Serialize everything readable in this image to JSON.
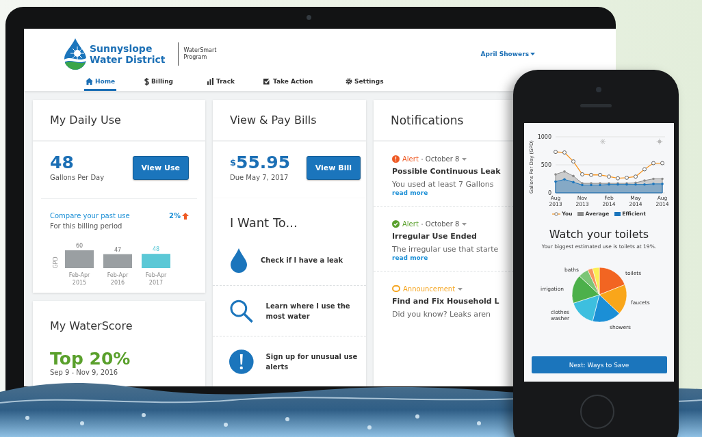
{
  "header": {
    "logo_lines": [
      "Sunnyslope",
      "Water District"
    ],
    "program_lines": [
      "WaterSmart",
      "Program"
    ],
    "user": "April Showers"
  },
  "nav": [
    {
      "kind": "home",
      "label": "Home",
      "selected": true
    },
    {
      "kind": "dollar",
      "label": "Billing",
      "selected": false
    },
    {
      "kind": "bars",
      "label": "Track",
      "selected": false
    },
    {
      "kind": "check",
      "label": "Take Action",
      "selected": false
    },
    {
      "kind": "gear",
      "label": "Settings",
      "selected": false
    }
  ],
  "daily_use": {
    "title": "My Daily Use",
    "value": "48",
    "unit": "Gallons Per Day",
    "button": "View Use",
    "compare_link": "Compare your past use",
    "change": "2%",
    "period": "For this billing period",
    "chart_data": {
      "type": "bar",
      "ylabel": "GPD",
      "categories": [
        "Feb-Apr 2015",
        "Feb-Apr 2016",
        "Feb-Apr 2017"
      ],
      "values": [
        60,
        47,
        48
      ],
      "data_labels": true
    }
  },
  "water_score": {
    "title": "My WaterScore",
    "rank": "Top 20%",
    "dates": "Sep 9 - Nov 9, 2016"
  },
  "bills": {
    "title": "View & Pay Bills",
    "currency": "$",
    "amount": "55.95",
    "due": "Due May 7, 2017",
    "button": "View Bill"
  },
  "actions": {
    "title": "I Want To...",
    "items": [
      {
        "kind": "drop",
        "label": "Check if I have a leak"
      },
      {
        "kind": "search",
        "label": "Learn where I use the most water"
      },
      {
        "kind": "exclamation",
        "label": "Sign up for unusual use alerts"
      }
    ]
  },
  "notifications": {
    "title": "Notifications",
    "items": [
      {
        "kind": "alert",
        "color": "#ef5a24",
        "type_label": "Alert",
        "date": "October 8",
        "title": "Possible Continuous Leak",
        "body": "You used at least 7 Gallons",
        "link": "read more"
      },
      {
        "kind": "resolved",
        "color": "#5aa02c",
        "type_label": "Alert",
        "date": "October 8",
        "title": "Irregular Use Ended",
        "body": "The irregular use that starte",
        "link": "read more"
      },
      {
        "kind": "announcement",
        "color": "#f5a623",
        "type_label": "Announcement",
        "title": "Find and Fix Household L",
        "body": "Did you know? Leaks aren"
      }
    ]
  },
  "phone": {
    "usage_chart": {
      "chart_data": {
        "type": "line",
        "ylabel": "Gallons Per Day (GPD)",
        "categories": [
          "Aug 2013",
          null,
          null,
          "Nov 2013",
          null,
          null,
          "Feb 2014",
          null,
          null,
          "May 2014",
          null,
          null,
          "Aug 2014"
        ],
        "ylim": [
          0,
          1000
        ],
        "yticks": [
          0,
          500,
          1000
        ],
        "legend": "bottom",
        "series": [
          {
            "name": "You",
            "type": "line",
            "marker": "circle",
            "color": "#f7941d",
            "values": [
              730,
              720,
              560,
              330,
              320,
              320,
              290,
              260,
              270,
              290,
              420,
              530,
              530
            ]
          },
          {
            "name": "Average",
            "type": "area",
            "color": "#8c8c8c",
            "values": [
              330,
              380,
              300,
              170,
              170,
              170,
              170,
              170,
              170,
              180,
              220,
              250,
              250
            ]
          },
          {
            "name": "Efficient",
            "type": "area",
            "color": "#1b75bc",
            "values": [
              200,
              240,
              190,
              140,
              140,
              140,
              150,
              150,
              150,
              150,
              150,
              160,
              160
            ]
          }
        ]
      }
    },
    "headline": "Watch your toilets",
    "subtext": "Your biggest estimated use is toilets at 19%.",
    "pie_labels": [
      "baths",
      "toilets",
      "irrigation",
      "faucets",
      "clothes washer",
      "showers"
    ],
    "button": "Next: Ways to Save"
  }
}
